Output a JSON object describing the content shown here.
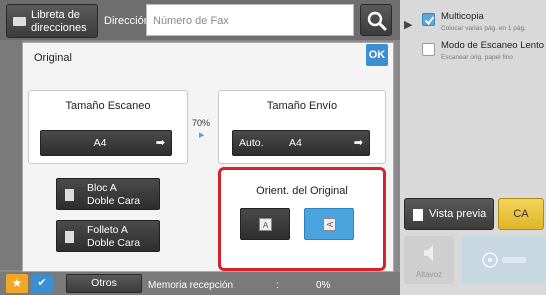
{
  "header": {
    "address_book_label_line1": "Libreta de",
    "address_book_label_line2": "direcciones",
    "address_label": "Dirección",
    "fax_placeholder": "Número de Fax"
  },
  "right_panel": {
    "options": [
      {
        "title": "Multicopia",
        "subtitle": "Colocar varias pág. en 1 pág.",
        "checked": true
      },
      {
        "title": "Modo de Escaneo Lento",
        "subtitle": "Escanear orig. papel fino",
        "checked": false
      }
    ],
    "preview_label": "Vista previa",
    "ca_label": "CA",
    "speaker_label": "Altavoz"
  },
  "dialog": {
    "title": "Original",
    "ok_label": "OK",
    "scan_size": {
      "title": "Tamaño Escaneo",
      "value": "A4"
    },
    "ratio": "70%",
    "send_size": {
      "title": "Tamaño Envío",
      "mode": "Auto.",
      "value": "A4"
    },
    "bloc_line1": "Bloc A",
    "bloc_line2": "Doble Cara",
    "folleto_line1": "Folleto A",
    "folleto_line2": "Doble Cara",
    "orientation": {
      "title": "Orient. del Original",
      "options": [
        "A",
        "A"
      ],
      "selected_index": 1
    }
  },
  "footer": {
    "others_label": "Otros",
    "memory_label": "Memoria recepción",
    "memory_sep": ":",
    "memory_value": "0%"
  },
  "colors": {
    "accent_blue": "#3b8fd0",
    "highlight_red": "#d6232a",
    "clear_yellow": "#f3d45a",
    "favorite_orange": "#f1a726"
  }
}
